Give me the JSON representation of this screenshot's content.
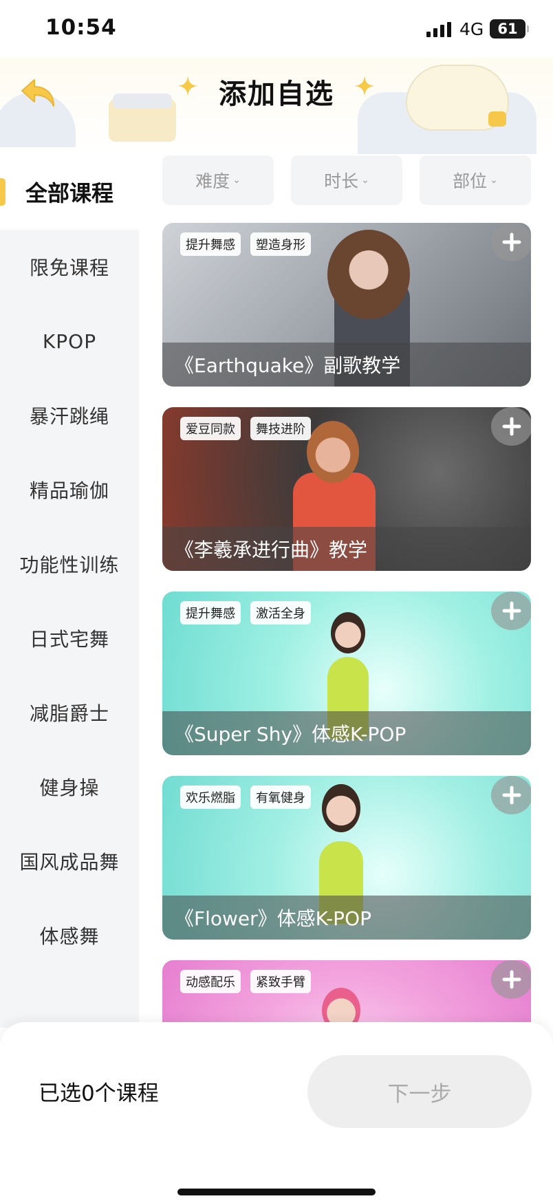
{
  "status_bar": {
    "time": "10:54",
    "network": "4G",
    "battery": "61"
  },
  "header": {
    "title": "添加自选"
  },
  "sidebar": {
    "active": "全部课程",
    "items": [
      {
        "label": "限免课程"
      },
      {
        "label": "KPOP"
      },
      {
        "label": "暴汗跳绳"
      },
      {
        "label": "精品瑜伽"
      },
      {
        "label": "功能性训练"
      },
      {
        "label": "日式宅舞"
      },
      {
        "label": "减脂爵士"
      },
      {
        "label": "健身操"
      },
      {
        "label": "国风成品舞"
      },
      {
        "label": "体感舞"
      }
    ]
  },
  "filters": [
    {
      "label": "难度"
    },
    {
      "label": "时长"
    },
    {
      "label": "部位"
    }
  ],
  "courses": [
    {
      "title": "《Earthquake》副歌教学",
      "tags": [
        "提升舞感",
        "塑造身形"
      ]
    },
    {
      "title": "《李羲承进行曲》教学",
      "tags": [
        "爱豆同款",
        "舞技进阶"
      ]
    },
    {
      "title": "《Super Shy》体感K-POP",
      "tags": [
        "提升舞感",
        "激活全身"
      ]
    },
    {
      "title": "《Flower》体感K-POP",
      "tags": [
        "欢乐燃脂",
        "有氧健身"
      ]
    },
    {
      "title": "",
      "tags": [
        "动感配乐",
        "紧致手臂"
      ]
    }
  ],
  "footer": {
    "selected_text": "已选0个课程",
    "next_label": "下一步"
  },
  "colors": {
    "accent": "#f7c948",
    "sidebar_bg": "#f4f5f7",
    "disabled_btn": "#eeeeef"
  }
}
